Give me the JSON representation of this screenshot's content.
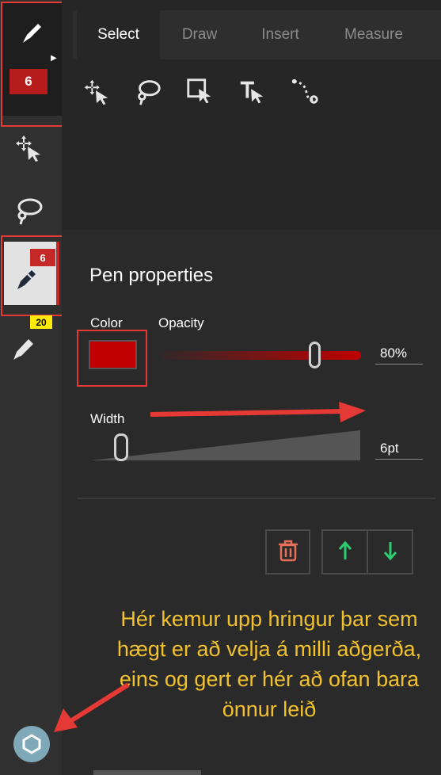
{
  "tabs": [
    {
      "label": "Select",
      "active": true
    },
    {
      "label": "Draw",
      "active": false
    },
    {
      "label": "Insert",
      "active": false
    },
    {
      "label": "Measure",
      "active": false
    }
  ],
  "toolbar_icons": [
    "move-select-icon",
    "lasso-select-icon",
    "rect-select-icon",
    "text-select-icon",
    "path-select-icon"
  ],
  "rail": {
    "active_pen_size": "6",
    "pen_badge": "6",
    "highlighter_badge": "20",
    "icons": [
      "pen-icon",
      "move-select-icon",
      "lasso-select-icon",
      "pen-tool-icon",
      "highlighter-icon",
      "hexagon-menu-icon"
    ]
  },
  "pen_properties": {
    "title": "Pen properties",
    "color_label": "Color",
    "color_value": "#c00000",
    "opacity_label": "Opacity",
    "opacity_value": "80%",
    "opacity_fraction": 0.8,
    "width_label": "Width",
    "width_value": "6pt"
  },
  "actions": [
    "trash-icon",
    "arrow-up-icon",
    "arrow-down-icon"
  ],
  "annotation": "Hér kemur upp hringur þar sem hægt er að velja á milli aðgerða, eins og gert er hér að ofan bara önnur leið",
  "colors": {
    "accent_red": "#e53935",
    "annotation_yellow": "#f2c12e",
    "green": "#2ecc71",
    "trash": "#e8705a"
  }
}
